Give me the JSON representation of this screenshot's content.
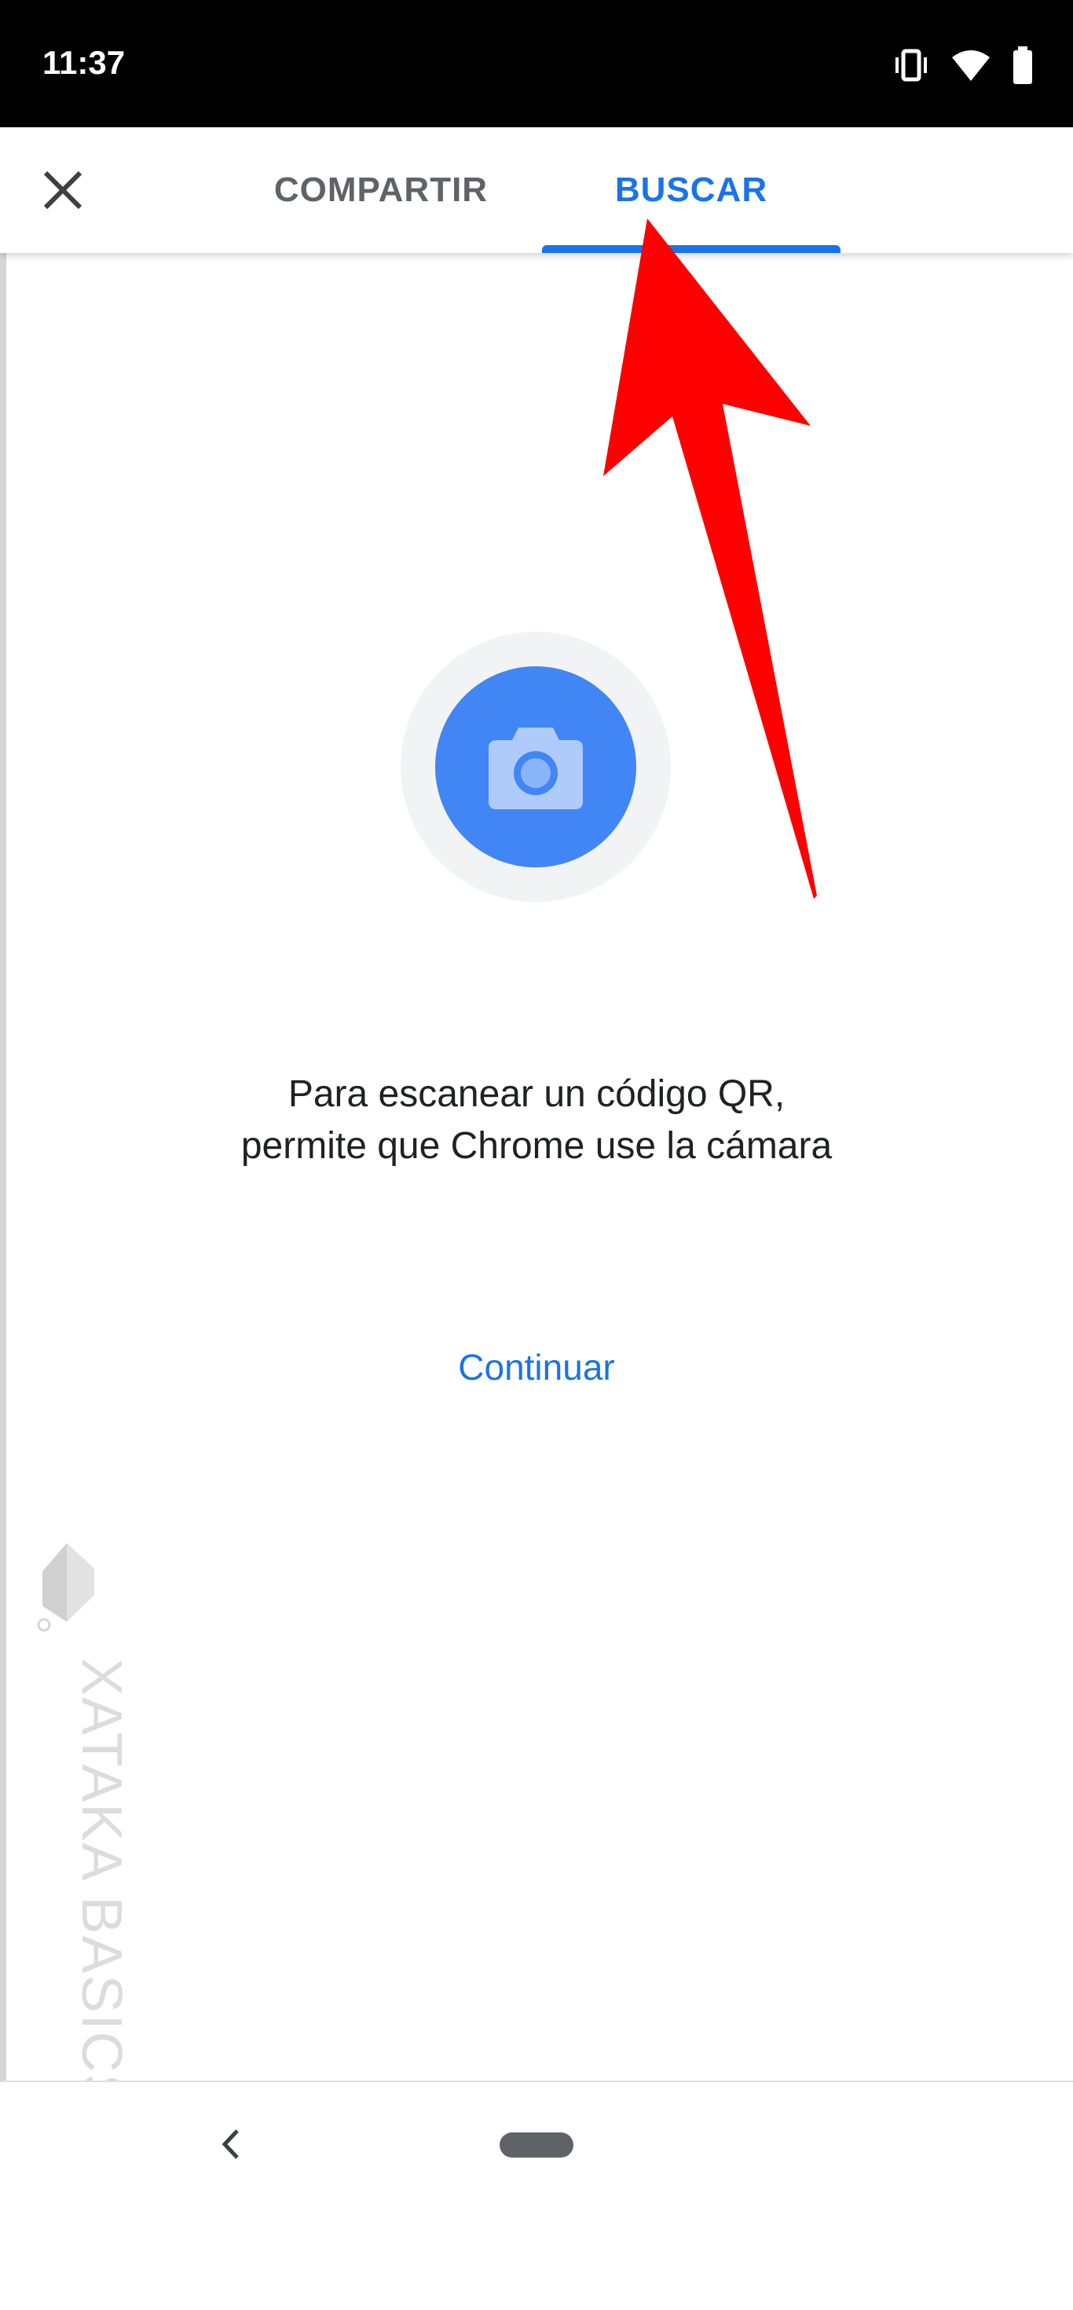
{
  "status_bar": {
    "time": "11:37",
    "icons": [
      "vibrate-icon",
      "wifi-icon",
      "battery-icon"
    ]
  },
  "top_bar": {
    "close_icon": "close-icon",
    "tabs": [
      {
        "label": "COMPARTIR",
        "selected": false
      },
      {
        "label": "BUSCAR",
        "selected": true
      }
    ]
  },
  "main": {
    "camera_icon": "camera-icon",
    "message": "Para escanear un código QR, permite que Chrome use la cámara",
    "continue_label": "Continuar"
  },
  "watermark": {
    "text": "XATAKA BASICS"
  },
  "annotation": {
    "arrow_color": "#ff0000",
    "points_to": "BUSCAR"
  },
  "nav_bar": {
    "back_icon": "back-icon",
    "home_icon": "home-pill-icon"
  },
  "colors": {
    "accent": "#1a73e8",
    "camera_circle": "#4285f4",
    "camera_ring": "#f1f3f4",
    "tab_inactive": "#5f6368",
    "text": "#202124"
  }
}
